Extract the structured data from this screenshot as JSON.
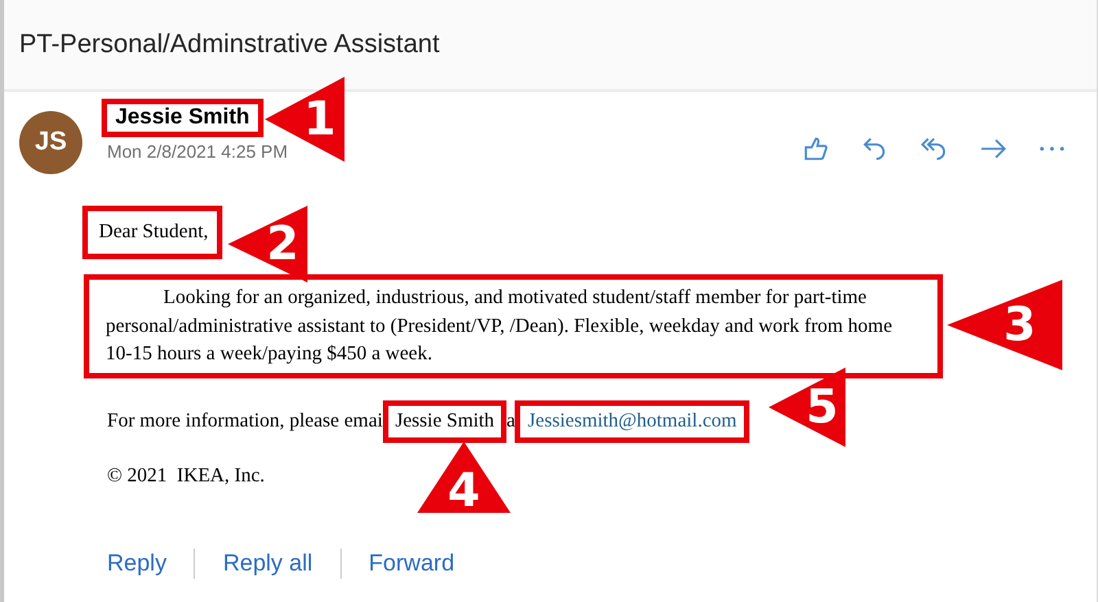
{
  "window": {
    "title": "PT-Personal/Adminstrative Assistant"
  },
  "message": {
    "sender_initials": "JS",
    "sender": "Jessie Smith",
    "date": "Mon 2/8/2021 4:25 PM"
  },
  "body": {
    "greeting": "Dear Student,",
    "paragraph": "Looking for an organized, industrious, and motivated student/staff member for part-time personal/administrative assistant to (President/VP, /Dean). Flexible, weekday and work from home 10-15 hours a week/paying $450 a week.",
    "contact": {
      "lead": "For more information, please emai",
      "name": "Jessie Smith",
      "joiner": "a",
      "email": "Jessiesmith@hotmail.com"
    },
    "copyright": "© 2021  IKEA, Inc."
  },
  "footer_links": [
    "Reply",
    "Reply all",
    "Forward"
  ],
  "callouts": [
    {
      "number": "1",
      "kind": "left"
    },
    {
      "number": "2",
      "kind": "left"
    },
    {
      "number": "3",
      "kind": "left"
    },
    {
      "number": "4",
      "kind": "up"
    },
    {
      "number": "5",
      "kind": "left"
    }
  ]
}
